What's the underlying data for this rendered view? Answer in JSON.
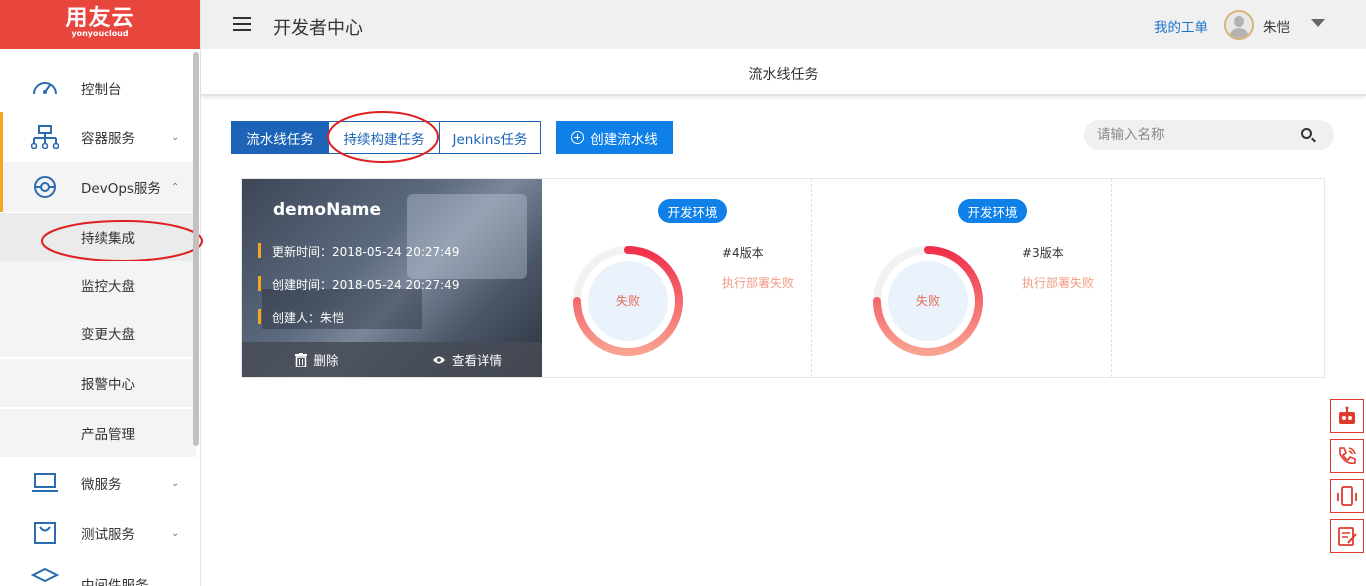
{
  "logo": {
    "brand": "用友云",
    "sub": "yonyoucloud"
  },
  "sidebar": {
    "items": [
      {
        "label": "控制台",
        "icon": "dashboard-icon"
      },
      {
        "label": "容器服务",
        "icon": "network-icon",
        "chevron": "⌄"
      },
      {
        "label": "DevOps服务",
        "icon": "devops-icon",
        "chevron": "⌃"
      },
      {
        "label": "持续集成"
      },
      {
        "label": "监控大盘"
      },
      {
        "label": "变更大盘"
      },
      {
        "label": "报警中心"
      },
      {
        "label": "产品管理"
      },
      {
        "label": "微服务",
        "icon": "laptop-icon",
        "chevron": "⌄"
      },
      {
        "label": "测试服务",
        "icon": "bag-icon",
        "chevron": "⌄"
      },
      {
        "label": "中间件服务",
        "icon": "layers-icon"
      }
    ]
  },
  "header": {
    "title": "开发者中心",
    "work_order": "我的工单",
    "username": "朱恺"
  },
  "page": {
    "title": "流水线任务"
  },
  "tabs": [
    {
      "label": "流水线任务",
      "selected": true
    },
    {
      "label": "持续构建任务",
      "selected": false
    },
    {
      "label": "Jenkins任务",
      "selected": false
    }
  ],
  "create_button": "创建流水线",
  "search": {
    "placeholder": "请输入名称",
    "value": ""
  },
  "card": {
    "name": "demoName",
    "updated": "更新时间：2018-05-24 20:27:49",
    "created": "创建时间：2018-05-24 20:27:49",
    "creator": "创建人：朱恺",
    "delete_label": "删除",
    "detail_label": "查看详情",
    "envs": [
      {
        "badge": "开发环境",
        "version": "#4版本",
        "status": "执行部署失败",
        "ring_label": "失败"
      },
      {
        "badge": "开发环境",
        "version": "#3版本",
        "status": "执行部署失败",
        "ring_label": "失败"
      }
    ]
  },
  "colors": {
    "brand_red": "#e8463c",
    "primary_blue": "#1d63b8",
    "accent_blue": "#0e80e8",
    "fail": "#f0304a",
    "orange_bar": "#f5a623"
  }
}
